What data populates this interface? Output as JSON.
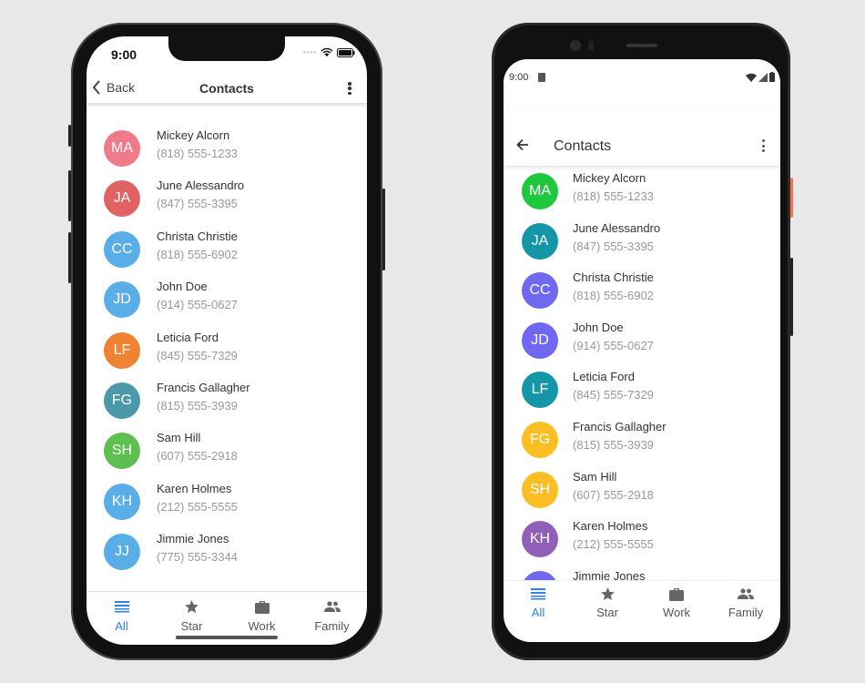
{
  "ios": {
    "status_time": "9:00",
    "header": {
      "back_label": "Back",
      "title": "Contacts"
    },
    "avatar_colors": [
      "#ee7a8a",
      "#e06262",
      "#5aaee8",
      "#5aaee8",
      "#ef8233",
      "#4a98a8",
      "#5cbf4f",
      "#5aaee8",
      "#5aaee8"
    ]
  },
  "android": {
    "status_time": "9:00",
    "header": {
      "title": "Contacts"
    },
    "avatar_colors": [
      "#1ec83c",
      "#1596a8",
      "#7068f0",
      "#7068f0",
      "#1596a8",
      "#fbbf24",
      "#fbbf24",
      "#9060b8",
      "#7068f0"
    ]
  },
  "contacts": [
    {
      "initials": "MA",
      "name": "Mickey Alcorn",
      "phone": "(818) 555-1233"
    },
    {
      "initials": "JA",
      "name": "June Alessandro",
      "phone": "(847) 555-3395"
    },
    {
      "initials": "CC",
      "name": "Christa Christie",
      "phone": "(818) 555-6902"
    },
    {
      "initials": "JD",
      "name": "John Doe",
      "phone": "(914) 555-0627"
    },
    {
      "initials": "LF",
      "name": "Leticia Ford",
      "phone": "(845) 555-7329"
    },
    {
      "initials": "FG",
      "name": "Francis Gallagher",
      "phone": "(815) 555-3939"
    },
    {
      "initials": "SH",
      "name": "Sam Hill",
      "phone": "(607) 555-2918"
    },
    {
      "initials": "KH",
      "name": "Karen Holmes",
      "phone": "(212) 555-5555"
    },
    {
      "initials": "JJ",
      "name": "Jimmie Jones",
      "phone": "(775) 555-3344"
    }
  ],
  "tabs": [
    {
      "label": "All",
      "icon": "list-icon",
      "active": true
    },
    {
      "label": "Star",
      "icon": "star-icon"
    },
    {
      "label": "Work",
      "icon": "briefcase-icon"
    },
    {
      "label": "Family",
      "icon": "people-icon"
    }
  ],
  "accent": "#2f80ed"
}
